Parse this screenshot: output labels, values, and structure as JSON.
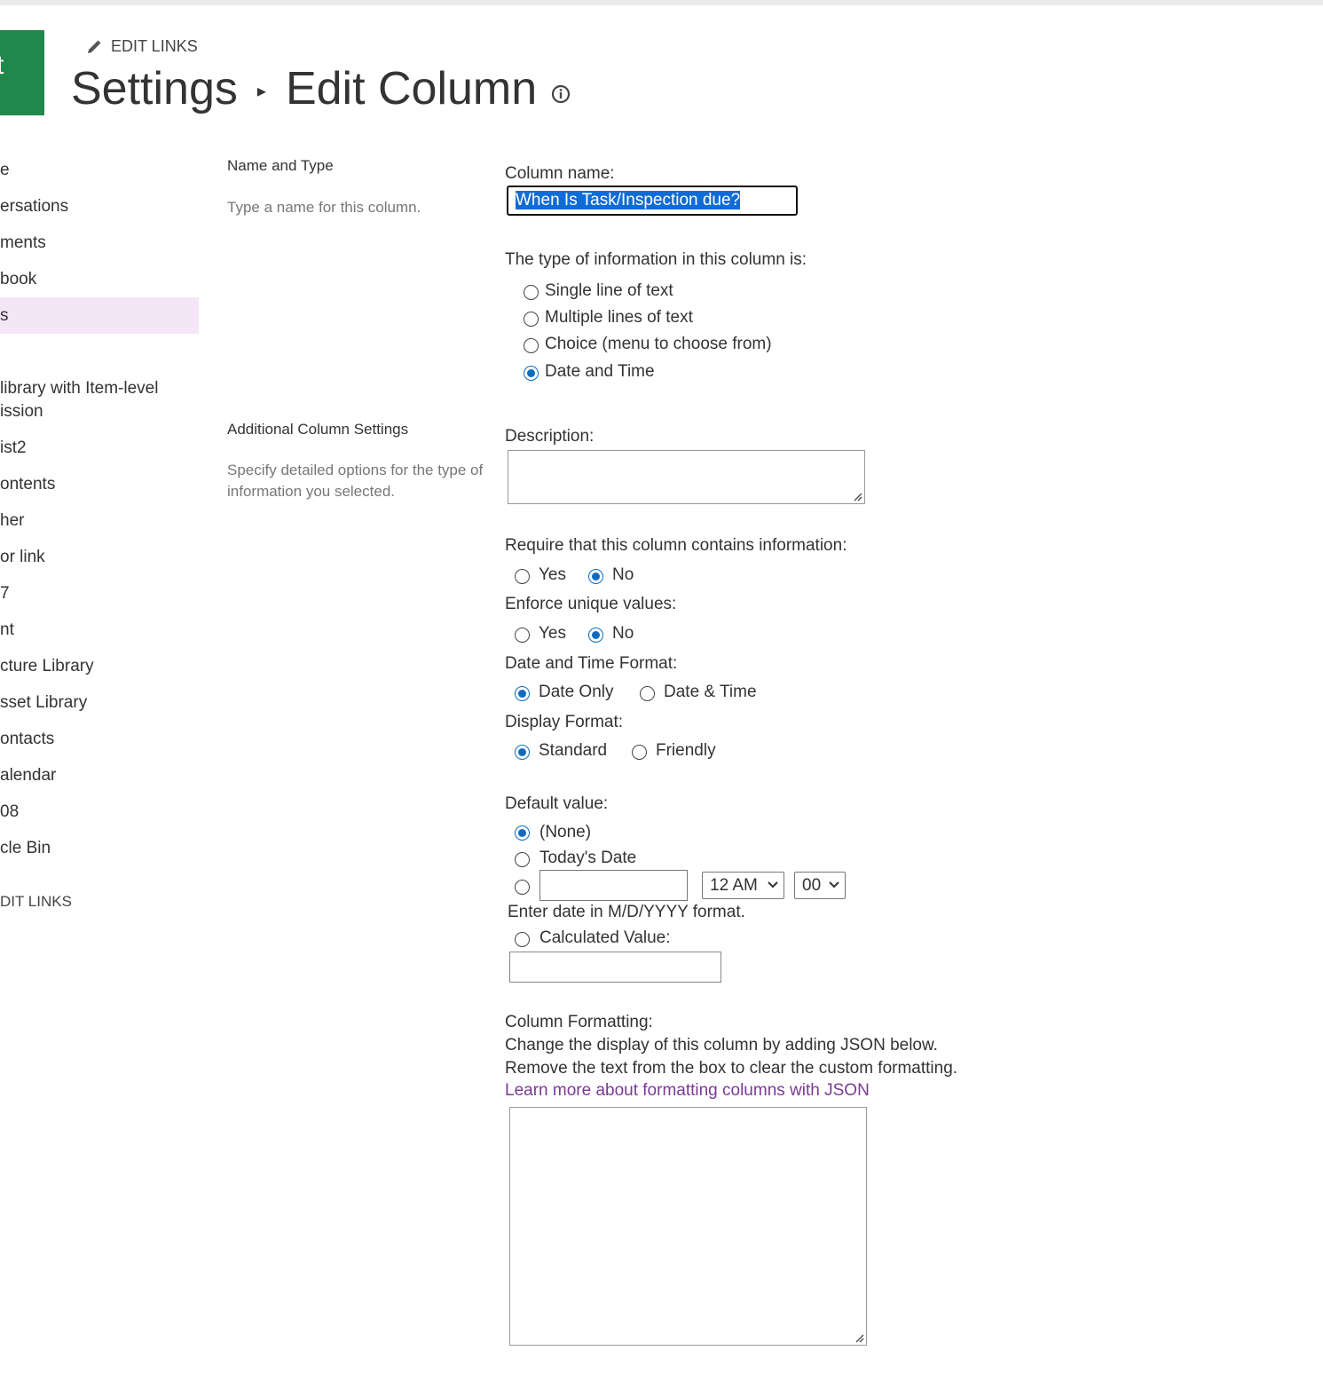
{
  "header": {
    "logo_letter": "t",
    "edit_links": "EDIT LINKS",
    "title_part1": "Settings",
    "title_separator": "▸",
    "title_part2": "Edit Column"
  },
  "leftnav": {
    "items": [
      {
        "label": "e"
      },
      {
        "label": "ersations"
      },
      {
        "label": "ments"
      },
      {
        "label": "book"
      },
      {
        "label": "s",
        "selected": true
      },
      {
        "label": "library with Item-level"
      },
      {
        "label": "ission"
      },
      {
        "label": "ist2"
      },
      {
        "label": "ontents"
      },
      {
        "label": "her"
      },
      {
        "label": "or link"
      },
      {
        "label": "7"
      },
      {
        "label": "nt"
      },
      {
        "label": "cture Library"
      },
      {
        "label": "sset Library"
      },
      {
        "label": "ontacts"
      },
      {
        "label": "alendar"
      },
      {
        "label": "08"
      },
      {
        "label": "cle Bin"
      }
    ],
    "edit_links": "DIT LINKS"
  },
  "name_type": {
    "title": "Name and Type",
    "desc": "Type a name for this column.",
    "column_name_label": "Column name:",
    "column_name_value": "When Is Task/Inspection due?",
    "type_label": "The type of information in this column is:",
    "types": [
      {
        "label": "Single line of text",
        "checked": false
      },
      {
        "label": "Multiple lines of text",
        "checked": false
      },
      {
        "label": "Choice (menu to choose from)",
        "checked": false
      },
      {
        "label": "Date and Time",
        "checked": true
      }
    ]
  },
  "additional": {
    "title": "Additional Column Settings",
    "desc": "Specify detailed options for the type of information you selected.",
    "description_label": "Description:",
    "require_label": "Require that this column contains information:",
    "require_yes": "Yes",
    "require_no": "No",
    "require_value": "No",
    "unique_label": "Enforce unique values:",
    "unique_yes": "Yes",
    "unique_no": "No",
    "unique_value": "No",
    "dt_format_label": "Date and Time Format:",
    "dt_date_only": "Date Only",
    "dt_date_time": "Date & Time",
    "dt_value": "Date Only",
    "display_label": "Display Format:",
    "display_standard": "Standard",
    "display_friendly": "Friendly",
    "display_value": "Standard",
    "default_label": "Default value:",
    "default_none": "(None)",
    "default_today": "Today's Date",
    "default_value": "(None)",
    "hour_value": "12 AM",
    "minute_value": "00",
    "date_hint": "Enter date in M/D/YYYY format.",
    "calculated_label": "Calculated Value:",
    "formatting_label": "Column Formatting:",
    "formatting_line1": "Change the display of this column by adding JSON below.",
    "formatting_line2": "Remove the text from the box to clear the custom formatting.",
    "formatting_link": "Learn more about formatting columns with JSON"
  },
  "colors": {
    "logo": "#21884c",
    "selected_nav": "#f4e6f6",
    "radio_checked": "#0f6cbd",
    "link": "#7a3a95",
    "selection": "#0f6cd5"
  }
}
